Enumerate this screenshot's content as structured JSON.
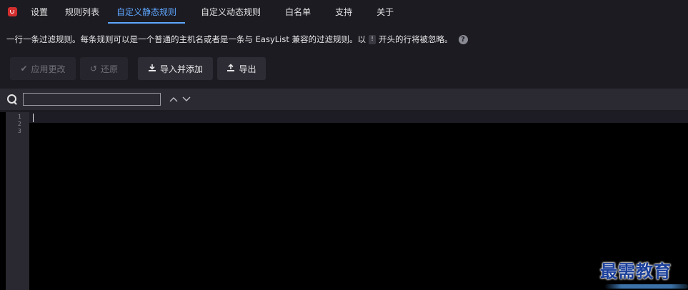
{
  "nav": {
    "tabs": [
      {
        "label": "设置"
      },
      {
        "label": "规则列表"
      },
      {
        "label": "自定义静态规则"
      },
      {
        "label": "自定义动态规则"
      },
      {
        "label": "白名单"
      },
      {
        "label": "支持"
      },
      {
        "label": "关于"
      }
    ],
    "active_tab": "自定义静态规则"
  },
  "description": {
    "text_before": "一行一条过滤规则。每条规则可以是一个普通的主机名或者是一条与 EasyList 兼容的过滤规则。以",
    "marker": "!",
    "text_after": "开头的行将被忽略。"
  },
  "toolbar": {
    "apply_label": "应用更改",
    "revert_label": "还原",
    "import_label": "导入并添加",
    "export_label": "导出"
  },
  "search": {
    "value": ""
  },
  "editor": {
    "line_numbers": [
      "1",
      "2",
      "3"
    ]
  },
  "watermark": {
    "text": "最需教育"
  },
  "colors": {
    "background": "#1c1b22",
    "accent": "#5ea7ff",
    "logo": "#d32f2f",
    "editor_bg": "#000000"
  },
  "icons": {
    "logo": "ublock-shield-icon",
    "apply": "check-icon",
    "revert": "undo-icon",
    "import": "import-icon",
    "export": "export-icon",
    "search": "search-icon",
    "prev": "chevron-up-icon",
    "next": "chevron-down-icon",
    "help": "help-icon"
  }
}
